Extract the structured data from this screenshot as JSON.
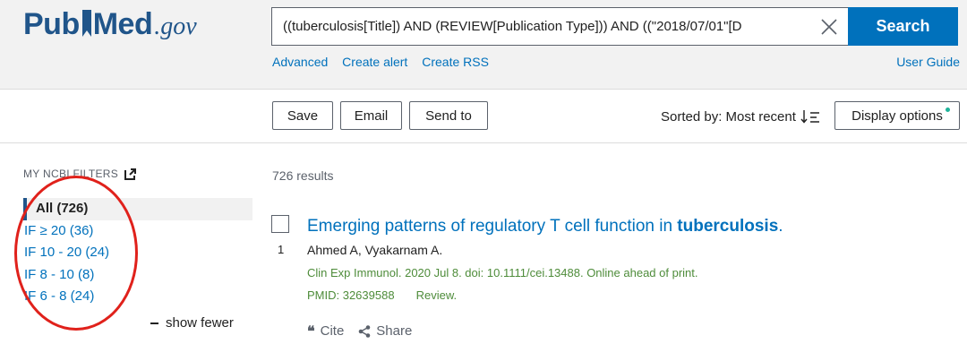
{
  "logo": {
    "part1": "Pub",
    "part2": "Med",
    "suffix": ".gov"
  },
  "search": {
    "query": "((tuberculosis[Title]) AND (REVIEW[Publication Type])) AND ((\"2018/07/01\"[D",
    "button_label": "Search"
  },
  "sublinks": [
    "Advanced",
    "Create alert",
    "Create RSS"
  ],
  "user_guide": "User Guide",
  "toolbar": {
    "save": "Save",
    "email": "Email",
    "send_to": "Send to",
    "sorted_by": "Sorted by: Most recent",
    "display_options": "Display options"
  },
  "filters": {
    "title": "MY NCBI FILTERS",
    "items": [
      {
        "label": "All (726)"
      },
      {
        "label": "IF ≥ 20 (36)"
      },
      {
        "label": "IF 10 - 20 (24)"
      },
      {
        "label": "IF 8 - 10 (8)"
      },
      {
        "label": "IF 6 - 8 (24)"
      }
    ],
    "show_fewer": "show fewer"
  },
  "results": {
    "count": "726 results",
    "items": [
      {
        "number": "1",
        "title_plain": "Emerging patterns of regulatory T cell function in ",
        "title_bold": "tuberculosis",
        "title_end": ".",
        "authors": "Ahmed A, Vyakarnam A.",
        "journal": "Clin Exp Immunol. 2020 Jul 8. doi: 10.1111/cei.13488. Online ahead of print.",
        "pmid": "PMID: 32639588",
        "type": "Review.",
        "cite": "Cite",
        "share": "Share"
      }
    ]
  },
  "colors": {
    "brand": "#20558a",
    "link": "#0071bc",
    "search_button": "#0071bc",
    "annotation": "#e0211b",
    "citation": "#4e8c3a"
  }
}
